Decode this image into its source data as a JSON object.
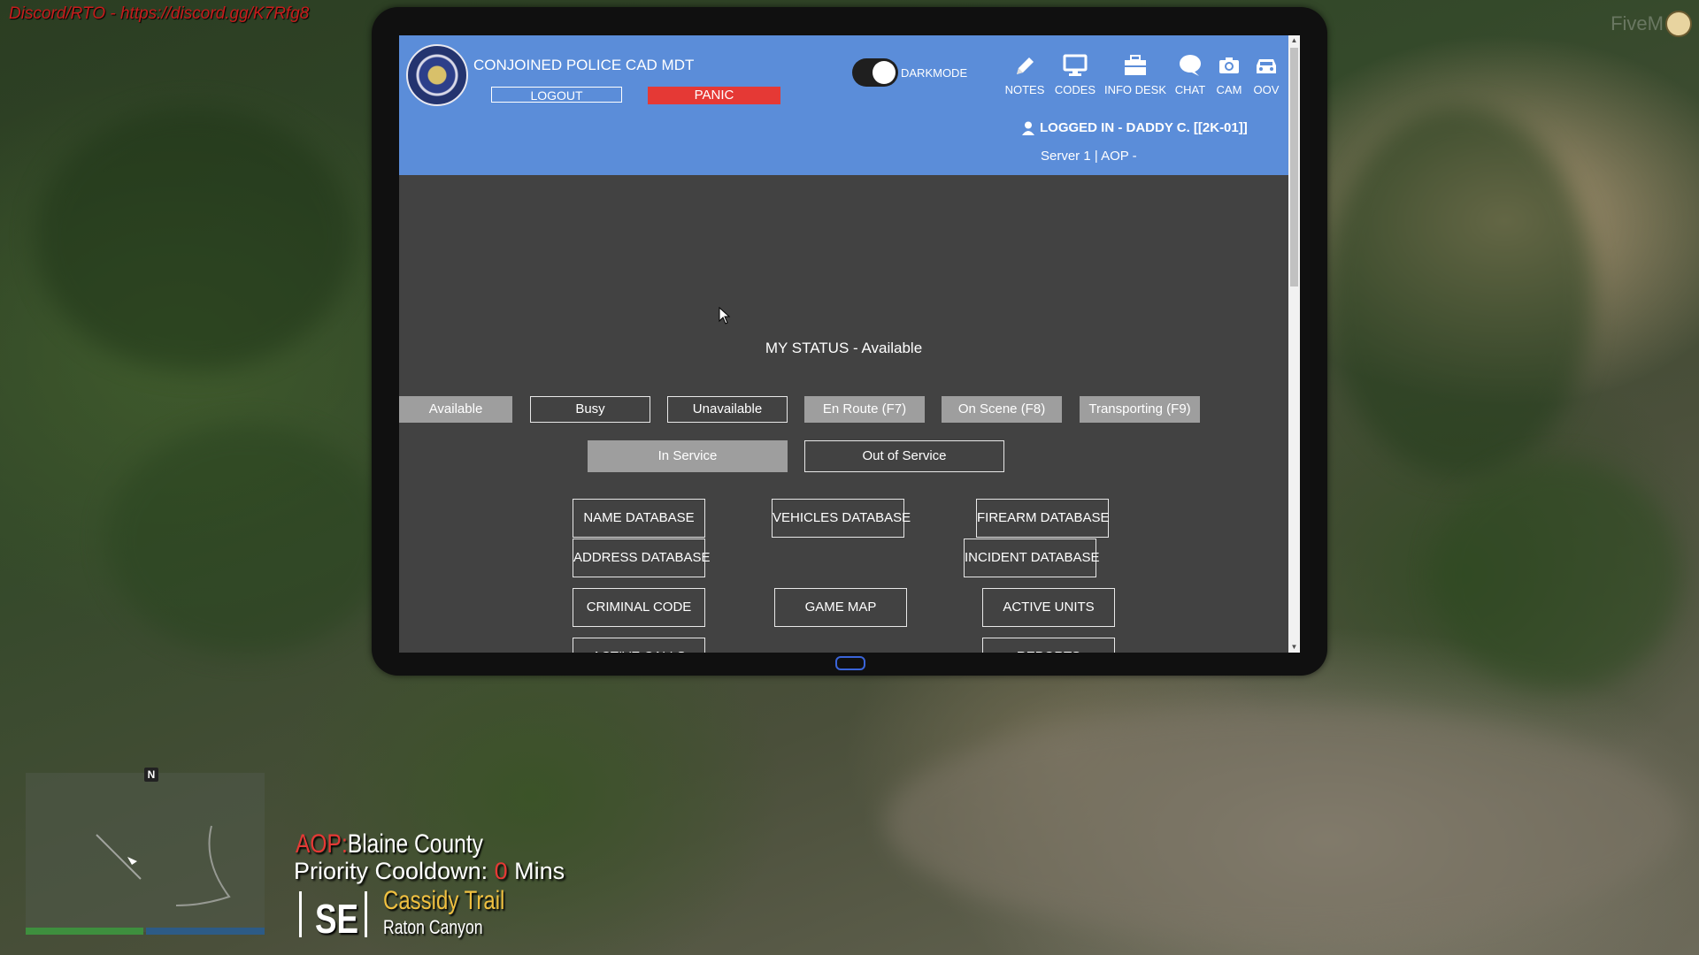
{
  "watermark": "Discord/RTO - https://discord.gg/K7Rfg8",
  "fivem": "FiveM",
  "cad": {
    "title": "CONJOINED POLICE CAD MDT",
    "logout_label": "LOGOUT",
    "panic_label": "PANIC",
    "darkmode_label": "DARKMODE",
    "darkmode_on": true,
    "nav": [
      {
        "label": "NOTES",
        "icon": "pencil-icon"
      },
      {
        "label": "CODES",
        "icon": "monitor-icon"
      },
      {
        "label": "INFO DESK",
        "icon": "briefcase-icon"
      },
      {
        "label": "CHAT",
        "icon": "chat-bubble-icon"
      },
      {
        "label": "CAM",
        "icon": "camera-icon"
      },
      {
        "label": "OOV",
        "icon": "car-icon"
      }
    ],
    "logged_in": "LOGGED IN - DADDY C. [[2K-01]]",
    "server": "Server 1 | AOP -"
  },
  "status": {
    "title": "MY STATUS - Available",
    "buttons": [
      "Available",
      "Busy",
      "Unavailable",
      "En Route (F7)",
      "On Scene (F8)",
      "Transporting (F9)"
    ],
    "service": [
      "In Service",
      "Out of Service"
    ]
  },
  "databases": {
    "name": "NAME DATABASE",
    "vehicles": "VEHICLES DATABASE",
    "firearm": "FIREARM DATABASE",
    "address": "ADDRESS DATABASE",
    "incident": "INCIDENT DATABASE",
    "criminal": "CRIMINAL CODE",
    "map": "GAME MAP",
    "units": "ACTIVE UNITS",
    "calls": "ACTIVE CALLS",
    "reports": "REPORTS"
  },
  "hud": {
    "aop_key": "AOP:",
    "aop_value": "Blaine County",
    "prio_label": "Priority Cooldown:",
    "prio_value": "0",
    "prio_unit": "Mins",
    "direction": "SE",
    "street": "Cassidy Trail",
    "zone": "Raton Canyon",
    "compass": "N"
  },
  "colors": {
    "header": "#5b8dd9",
    "panel": "#424242",
    "panic": "#e53935"
  }
}
